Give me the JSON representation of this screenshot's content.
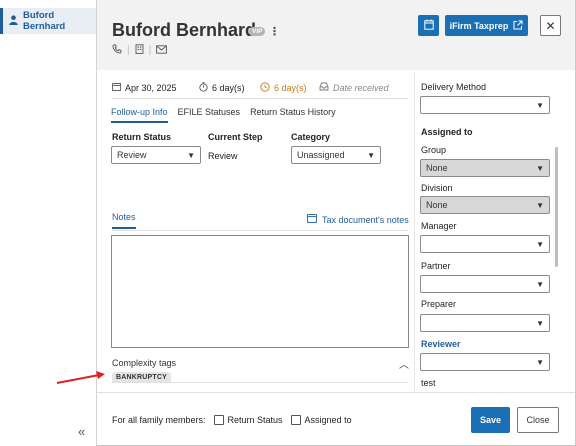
{
  "sidebar": {
    "items": [
      {
        "label": "Buford Bernhard",
        "icon": "person-icon"
      }
    ],
    "collapse_glyph": "«"
  },
  "header": {
    "client_name": "Buford Bernhard",
    "badge": "VIP",
    "kebab": "⋮",
    "ifirm_label": "iFirm Taxprep",
    "close_glyph": "✕"
  },
  "meta": {
    "date": "Apr 30, 2025",
    "days_elapsed": "6 day(s)",
    "days_pending": "6 day(s)",
    "date_received_placeholder": "Date received"
  },
  "tabs": [
    {
      "label": "Follow-up Info",
      "active": true
    },
    {
      "label": "EFILE Statuses",
      "active": false
    },
    {
      "label": "Return Status History",
      "active": false
    }
  ],
  "fields": {
    "return_status": {
      "label": "Return Status",
      "value": "Review"
    },
    "current_step": {
      "label": "Current Step",
      "value": "Review"
    },
    "category": {
      "label": "Category",
      "value": "Unassigned"
    }
  },
  "notes": {
    "tab_label": "Notes",
    "tax_docs_link": "Tax document's notes",
    "content": ""
  },
  "complexity": {
    "title": "Complexity tags",
    "tags": [
      "BANKRUPTCY"
    ]
  },
  "right_panel": {
    "delivery_method": {
      "label": "Delivery Method",
      "value": ""
    },
    "assigned_to_label": "Assigned to",
    "group": {
      "label": "Group",
      "value": "None"
    },
    "division": {
      "label": "Division",
      "value": "None"
    },
    "manager": {
      "label": "Manager",
      "value": ""
    },
    "partner": {
      "label": "Partner",
      "value": ""
    },
    "preparer": {
      "label": "Preparer",
      "value": ""
    },
    "reviewer": {
      "label": "Reviewer",
      "value": ""
    },
    "test": {
      "label": "test"
    }
  },
  "footer": {
    "family_label": "For all family members:",
    "return_status_cb": "Return Status",
    "assigned_to_cb": "Assigned to",
    "save_label": "Save",
    "close_label": "Close"
  },
  "colors": {
    "accent": "#1a6fb5",
    "link": "#1f5d99",
    "warning": "#c47a14",
    "annotation_arrow": "#e02020"
  }
}
